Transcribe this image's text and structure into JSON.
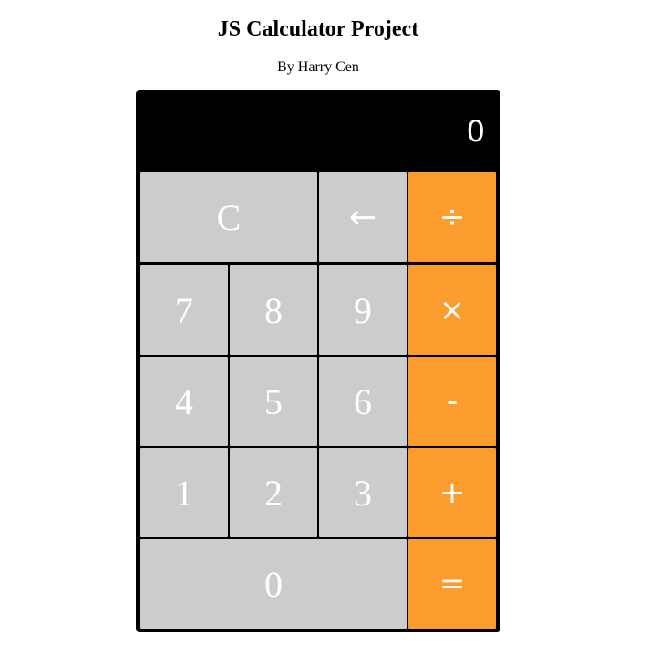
{
  "header": {
    "title": "JS Calculator Project",
    "subtitle": "By Harry Cen"
  },
  "display": {
    "value": "0"
  },
  "keys": {
    "clear": "C",
    "backspace": "←",
    "divide": "÷",
    "multiply": "×",
    "subtract": "-",
    "add": "+",
    "equals": "=",
    "seven": "7",
    "eight": "8",
    "nine": "9",
    "four": "4",
    "five": "5",
    "six": "6",
    "one": "1",
    "two": "2",
    "three": "3",
    "zero": "0"
  },
  "colors": {
    "number_key": "#cccccc",
    "operator_key": "#fc9b2e",
    "display_background": "#000000",
    "key_text": "#ffffff"
  }
}
